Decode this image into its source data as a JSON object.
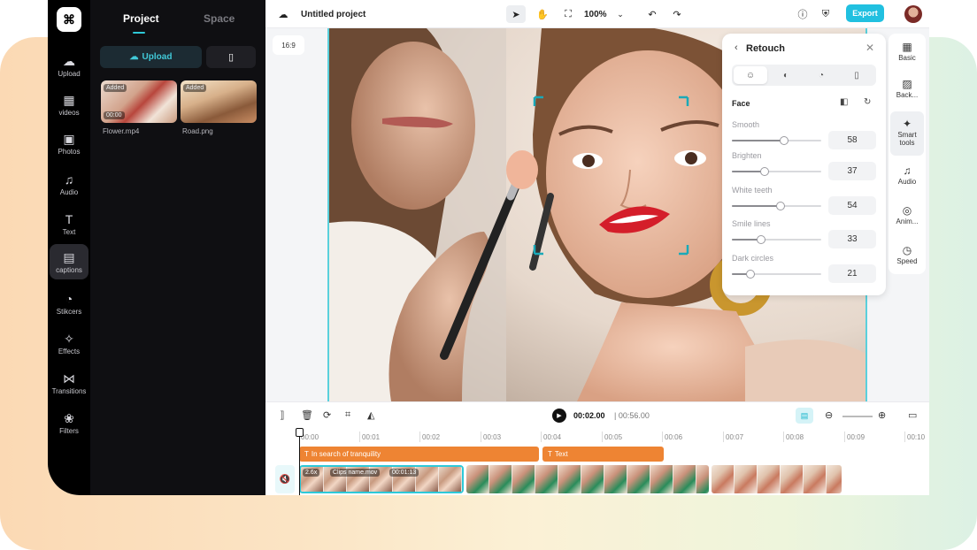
{
  "rail": {
    "logo": "⌘",
    "items": [
      {
        "label": "Upload",
        "icon": "☁"
      },
      {
        "label": "videos",
        "icon": "▦"
      },
      {
        "label": "Photos",
        "icon": "▣"
      },
      {
        "label": "Audio",
        "icon": "♫"
      },
      {
        "label": "Text",
        "icon": "T"
      },
      {
        "label": "captions",
        "icon": "▤"
      },
      {
        "label": "Stikcers",
        "icon": "◔"
      },
      {
        "label": "Effects",
        "icon": "✧"
      },
      {
        "label": "Transitions",
        "icon": "⋈"
      },
      {
        "label": "Filters",
        "icon": "❀"
      }
    ]
  },
  "panel": {
    "tabs": [
      "Project",
      "Space"
    ],
    "upload_label": "Upload",
    "media": [
      {
        "name": "Flower.mp4",
        "badge": "Added",
        "duration": "00:00"
      },
      {
        "name": "Road.png",
        "badge": "Added"
      }
    ]
  },
  "topbar": {
    "project_title": "Untitled project",
    "zoom": "100%",
    "export_label": "Export"
  },
  "canvas": {
    "ratio": "16:9"
  },
  "retouch": {
    "title": "Retouch",
    "section": "Face",
    "sliders": [
      {
        "label": "Smooth",
        "value": "58",
        "fraction": 0.58
      },
      {
        "label": "Brighten",
        "value": "37",
        "fraction": 0.37
      },
      {
        "label": "White teeth",
        "value": "54",
        "fraction": 0.54
      },
      {
        "label": "Smile lines",
        "value": "33",
        "fraction": 0.33
      },
      {
        "label": "Dark circles",
        "value": "21",
        "fraction": 0.21
      }
    ]
  },
  "right_panel": {
    "items": [
      {
        "label": "Basic",
        "icon": "▦"
      },
      {
        "label": "Back...",
        "icon": "▨"
      },
      {
        "label": "Smart tools",
        "icon": "✦"
      },
      {
        "label": "Audio",
        "icon": "♫"
      },
      {
        "label": "Anim...",
        "icon": "◎"
      },
      {
        "label": "Speed",
        "icon": "◷"
      }
    ]
  },
  "timeline": {
    "current_time": "00:02.00",
    "total_time": "00:56.00",
    "ruler": [
      "00:00",
      "00:01",
      "00:02",
      "00:03",
      "00:04",
      "00:05",
      "00:06",
      "00:07",
      "00:08",
      "00:09",
      "00:10"
    ],
    "text_clips": [
      "In search of tranquility",
      "Text"
    ],
    "video_clip": {
      "speed": "2.6x",
      "name": "Clips name.mov",
      "duration": "00:01:13"
    }
  },
  "colors": {
    "accent": "#21c0e0",
    "text_clip": "#ee8433",
    "selection": "#5ad0dc"
  }
}
